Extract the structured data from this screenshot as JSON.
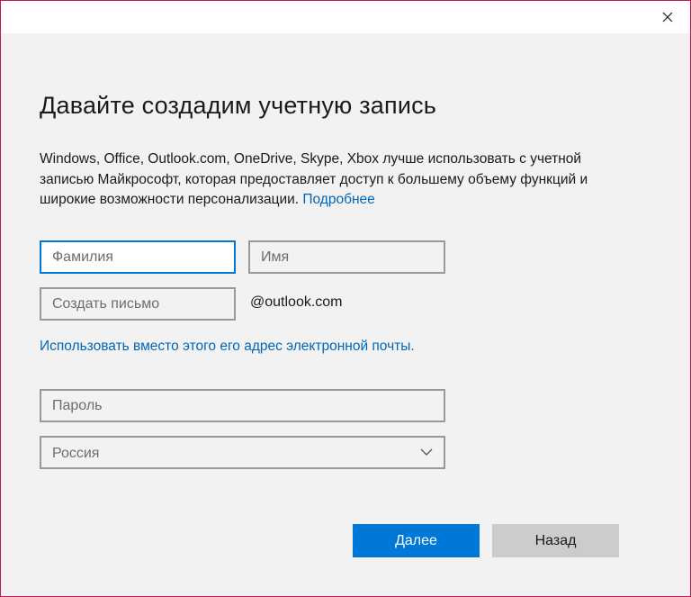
{
  "dialog": {
    "heading": "Давайте создадим учетную запись",
    "description": "Windows, Office, Outlook.com, OneDrive, Skype, Xbox лучше использовать с учетной записью Майкрософт, которая предоставляет доступ к большему объему функций и широкие возможности персонализации.",
    "learn_more": "Подробнее"
  },
  "form": {
    "surname_placeholder": "Фамилия",
    "name_placeholder": "Имя",
    "email_placeholder": "Создать письмо",
    "email_domain": "@outlook.com",
    "use_existing_email_link": "Использовать вместо этого его адрес электронной почты.",
    "password_placeholder": "Пароль",
    "country_selected": "Россия"
  },
  "buttons": {
    "next": "Далее",
    "back": "Назад"
  },
  "icons": {
    "close": "close-icon",
    "dropdown": "chevron-down-icon"
  },
  "colors": {
    "accent": "#0078d7",
    "link": "#0067b8",
    "window_border": "#c2185b",
    "background": "#f2f2f2"
  }
}
